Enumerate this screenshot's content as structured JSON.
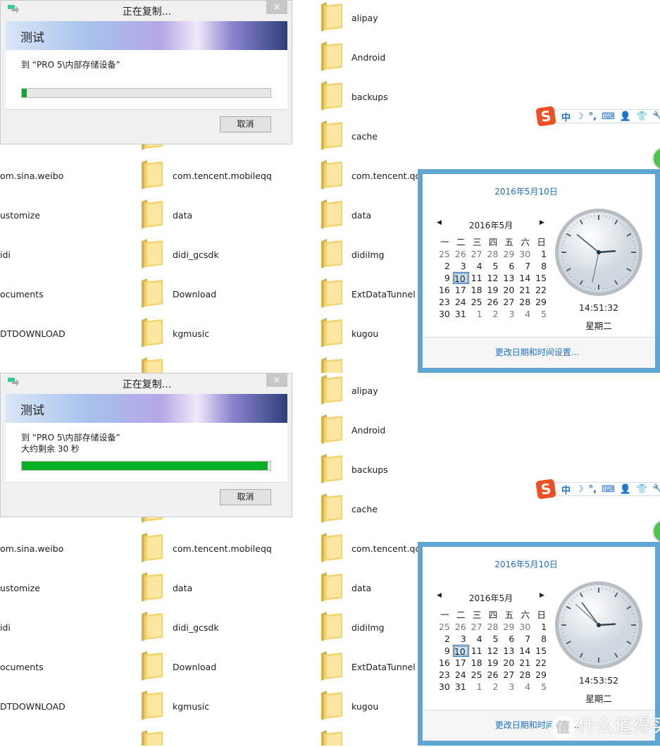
{
  "panels": [
    {
      "dialog": {
        "title": "正在复制...",
        "close": "×",
        "banner": "测试",
        "destination": "到 “PRO 5\\内部存储设备”",
        "remaining": "",
        "progress_percent": 2,
        "cancel": "取消"
      },
      "calendar": {
        "date": "2016年5月10日",
        "month": "2016年5月",
        "time": "14:51:32",
        "weekday": "星期二",
        "footer_link": "更改日期和时间设置..."
      }
    },
    {
      "dialog": {
        "title": "正在复制...",
        "close": "×",
        "banner": "测试",
        "destination": "到 “PRO 5\\内部存储设备”",
        "remaining": "大约剩余 30 秒",
        "progress_percent": 99,
        "cancel": "取消"
      },
      "calendar": {
        "date": "2016年5月10日",
        "month": "2016年5月",
        "time": "14:53:52",
        "weekday": "星期二",
        "footer_link": "更改日期和时间设置..."
      }
    }
  ],
  "folders": {
    "col0": [
      "om.sina.weibo",
      "ustomize",
      "idi",
      "ocuments",
      "DTDOWNLOAD"
    ],
    "col1": [
      "com.tencent.mobileqq",
      "data",
      "didi_gcsdk",
      "Download",
      "kgmusic"
    ],
    "col2": [
      "alipay",
      "Android",
      "backups",
      "cache",
      "com.tencent.qqli",
      "data",
      "didiImg",
      "ExtDataTunnel",
      "kugou"
    ]
  },
  "weekday_headers": [
    "一",
    "二",
    "三",
    "四",
    "五",
    "六",
    "日"
  ],
  "calendar_days": [
    [
      "25",
      "26",
      "27",
      "28",
      "29",
      "30",
      "1"
    ],
    [
      "2",
      "3",
      "4",
      "5",
      "6",
      "7",
      "8"
    ],
    [
      "9",
      "10",
      "11",
      "12",
      "13",
      "14",
      "15"
    ],
    [
      "16",
      "17",
      "18",
      "19",
      "20",
      "21",
      "22"
    ],
    [
      "23",
      "24",
      "25",
      "26",
      "27",
      "28",
      "29"
    ],
    [
      "30",
      "31",
      "1",
      "2",
      "3",
      "4",
      "5"
    ]
  ],
  "today": "10",
  "ime": {
    "logo": "S",
    "items": [
      "中",
      "☽",
      "°,",
      "⌨",
      "👤",
      "👕",
      "🔧"
    ]
  },
  "watermark": {
    "glyph": "值",
    "text": "什么值得买"
  },
  "colors": {
    "accent": "#1a6fce",
    "progress": "#06b025",
    "popup_border": "#5ea7d2",
    "folder": "#f3d46b"
  }
}
